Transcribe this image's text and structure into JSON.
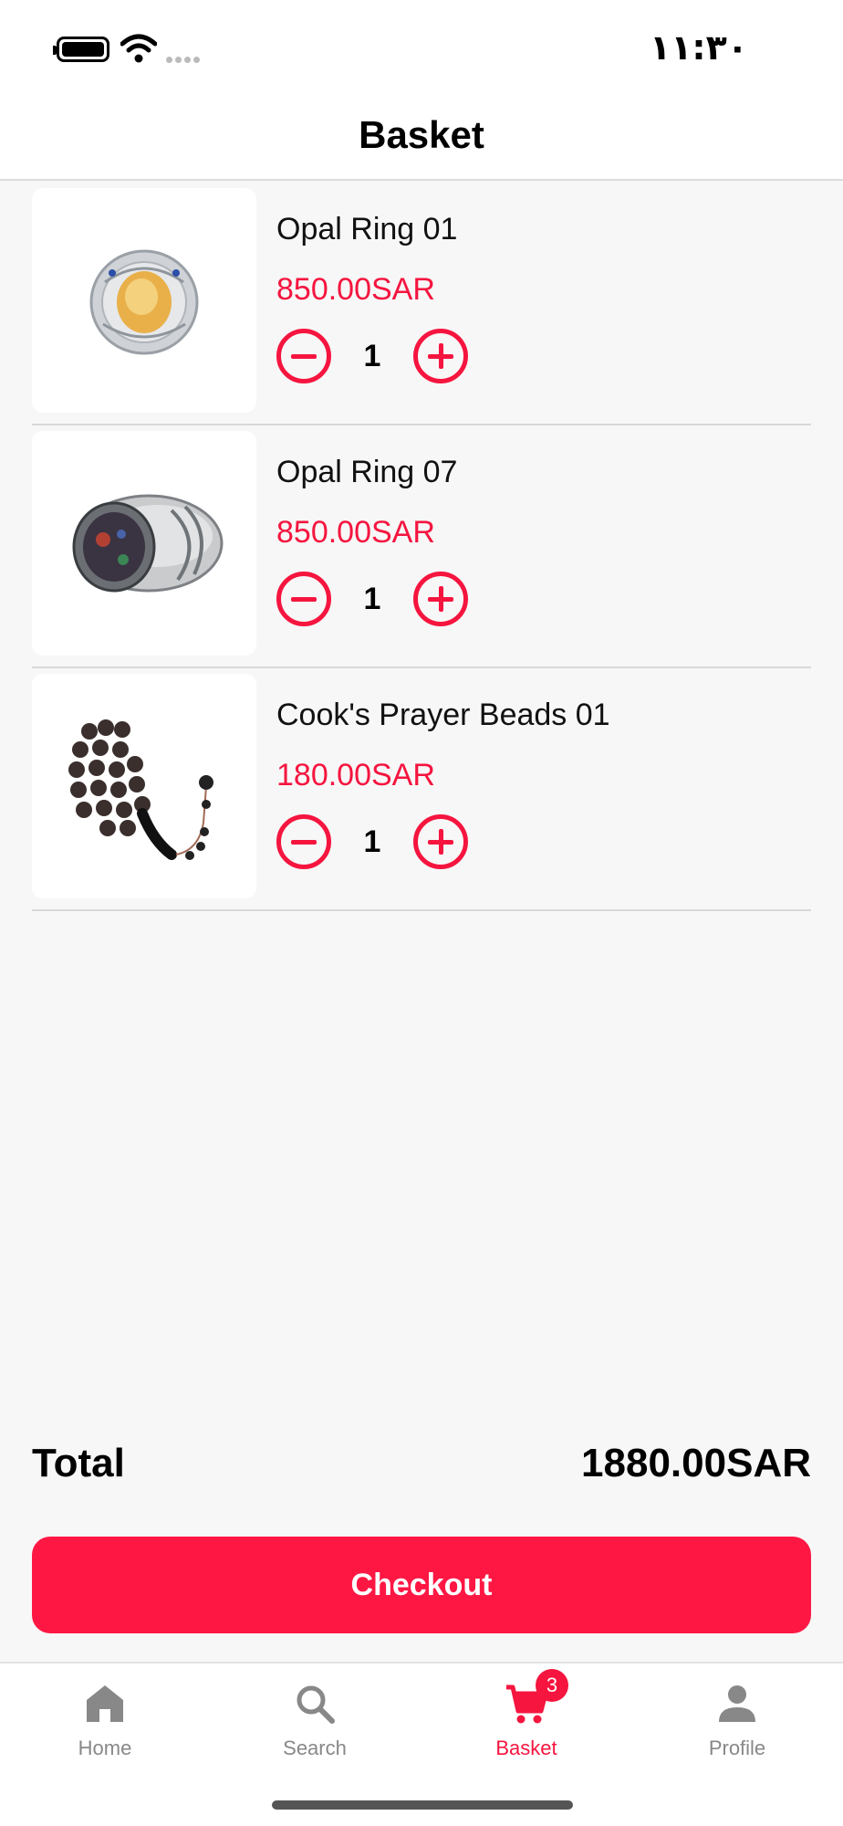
{
  "status_bar": {
    "time": "١١:٣٠",
    "icons": [
      "battery-icon",
      "wifi-icon",
      "signal-icon"
    ]
  },
  "header": {
    "title": "Basket"
  },
  "cart": {
    "items": [
      {
        "name": "Opal Ring 01",
        "price": "850.00SAR",
        "quantity": "1",
        "image": "opal-ring-01-image"
      },
      {
        "name": "Opal Ring 07",
        "price": "850.00SAR",
        "quantity": "1",
        "image": "opal-ring-07-image"
      },
      {
        "name": "Cook's Prayer Beads 01",
        "price": "180.00SAR",
        "quantity": "1",
        "image": "prayer-beads-image"
      }
    ]
  },
  "summary": {
    "total_label": "Total",
    "total_value": "1880.00SAR"
  },
  "checkout": {
    "label": "Checkout"
  },
  "nav": {
    "items": [
      {
        "label": "Home",
        "icon": "home-icon",
        "active": false
      },
      {
        "label": "Search",
        "icon": "search-icon",
        "active": false
      },
      {
        "label": "Basket",
        "icon": "cart-icon",
        "active": true,
        "badge": "3"
      },
      {
        "label": "Profile",
        "icon": "person-icon",
        "active": false
      }
    ]
  },
  "colors": {
    "accent": "#ff1744",
    "price": "#f5153f",
    "inactive": "#888888",
    "background": "#f7f7f7"
  }
}
